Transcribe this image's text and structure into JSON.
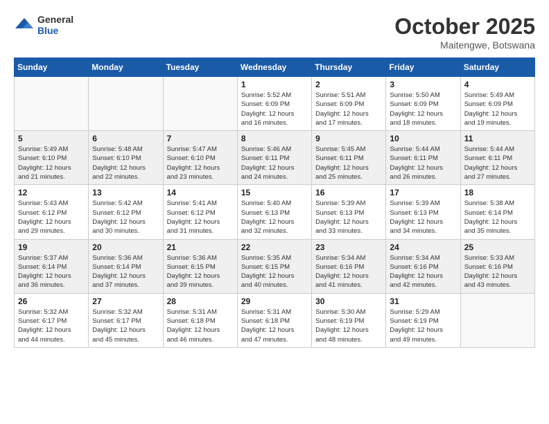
{
  "logo": {
    "general": "General",
    "blue": "Blue"
  },
  "header": {
    "month": "October 2025",
    "location": "Maitengwe, Botswana"
  },
  "weekdays": [
    "Sunday",
    "Monday",
    "Tuesday",
    "Wednesday",
    "Thursday",
    "Friday",
    "Saturday"
  ],
  "weeks": [
    [
      {
        "day": "",
        "info": ""
      },
      {
        "day": "",
        "info": ""
      },
      {
        "day": "",
        "info": ""
      },
      {
        "day": "1",
        "info": "Sunrise: 5:52 AM\nSunset: 6:09 PM\nDaylight: 12 hours\nand 16 minutes."
      },
      {
        "day": "2",
        "info": "Sunrise: 5:51 AM\nSunset: 6:09 PM\nDaylight: 12 hours\nand 17 minutes."
      },
      {
        "day": "3",
        "info": "Sunrise: 5:50 AM\nSunset: 6:09 PM\nDaylight: 12 hours\nand 18 minutes."
      },
      {
        "day": "4",
        "info": "Sunrise: 5:49 AM\nSunset: 6:09 PM\nDaylight: 12 hours\nand 19 minutes."
      }
    ],
    [
      {
        "day": "5",
        "info": "Sunrise: 5:49 AM\nSunset: 6:10 PM\nDaylight: 12 hours\nand 21 minutes."
      },
      {
        "day": "6",
        "info": "Sunrise: 5:48 AM\nSunset: 6:10 PM\nDaylight: 12 hours\nand 22 minutes."
      },
      {
        "day": "7",
        "info": "Sunrise: 5:47 AM\nSunset: 6:10 PM\nDaylight: 12 hours\nand 23 minutes."
      },
      {
        "day": "8",
        "info": "Sunrise: 5:46 AM\nSunset: 6:11 PM\nDaylight: 12 hours\nand 24 minutes."
      },
      {
        "day": "9",
        "info": "Sunrise: 5:45 AM\nSunset: 6:11 PM\nDaylight: 12 hours\nand 25 minutes."
      },
      {
        "day": "10",
        "info": "Sunrise: 5:44 AM\nSunset: 6:11 PM\nDaylight: 12 hours\nand 26 minutes."
      },
      {
        "day": "11",
        "info": "Sunrise: 5:44 AM\nSunset: 6:11 PM\nDaylight: 12 hours\nand 27 minutes."
      }
    ],
    [
      {
        "day": "12",
        "info": "Sunrise: 5:43 AM\nSunset: 6:12 PM\nDaylight: 12 hours\nand 29 minutes."
      },
      {
        "day": "13",
        "info": "Sunrise: 5:42 AM\nSunset: 6:12 PM\nDaylight: 12 hours\nand 30 minutes."
      },
      {
        "day": "14",
        "info": "Sunrise: 5:41 AM\nSunset: 6:12 PM\nDaylight: 12 hours\nand 31 minutes."
      },
      {
        "day": "15",
        "info": "Sunrise: 5:40 AM\nSunset: 6:13 PM\nDaylight: 12 hours\nand 32 minutes."
      },
      {
        "day": "16",
        "info": "Sunrise: 5:39 AM\nSunset: 6:13 PM\nDaylight: 12 hours\nand 33 minutes."
      },
      {
        "day": "17",
        "info": "Sunrise: 5:39 AM\nSunset: 6:13 PM\nDaylight: 12 hours\nand 34 minutes."
      },
      {
        "day": "18",
        "info": "Sunrise: 5:38 AM\nSunset: 6:14 PM\nDaylight: 12 hours\nand 35 minutes."
      }
    ],
    [
      {
        "day": "19",
        "info": "Sunrise: 5:37 AM\nSunset: 6:14 PM\nDaylight: 12 hours\nand 36 minutes."
      },
      {
        "day": "20",
        "info": "Sunrise: 5:36 AM\nSunset: 6:14 PM\nDaylight: 12 hours\nand 37 minutes."
      },
      {
        "day": "21",
        "info": "Sunrise: 5:36 AM\nSunset: 6:15 PM\nDaylight: 12 hours\nand 39 minutes."
      },
      {
        "day": "22",
        "info": "Sunrise: 5:35 AM\nSunset: 6:15 PM\nDaylight: 12 hours\nand 40 minutes."
      },
      {
        "day": "23",
        "info": "Sunrise: 5:34 AM\nSunset: 6:16 PM\nDaylight: 12 hours\nand 41 minutes."
      },
      {
        "day": "24",
        "info": "Sunrise: 5:34 AM\nSunset: 6:16 PM\nDaylight: 12 hours\nand 42 minutes."
      },
      {
        "day": "25",
        "info": "Sunrise: 5:33 AM\nSunset: 6:16 PM\nDaylight: 12 hours\nand 43 minutes."
      }
    ],
    [
      {
        "day": "26",
        "info": "Sunrise: 5:32 AM\nSunset: 6:17 PM\nDaylight: 12 hours\nand 44 minutes."
      },
      {
        "day": "27",
        "info": "Sunrise: 5:32 AM\nSunset: 6:17 PM\nDaylight: 12 hours\nand 45 minutes."
      },
      {
        "day": "28",
        "info": "Sunrise: 5:31 AM\nSunset: 6:18 PM\nDaylight: 12 hours\nand 46 minutes."
      },
      {
        "day": "29",
        "info": "Sunrise: 5:31 AM\nSunset: 6:18 PM\nDaylight: 12 hours\nand 47 minutes."
      },
      {
        "day": "30",
        "info": "Sunrise: 5:30 AM\nSunset: 6:19 PM\nDaylight: 12 hours\nand 48 minutes."
      },
      {
        "day": "31",
        "info": "Sunrise: 5:29 AM\nSunset: 6:19 PM\nDaylight: 12 hours\nand 49 minutes."
      },
      {
        "day": "",
        "info": ""
      }
    ]
  ]
}
